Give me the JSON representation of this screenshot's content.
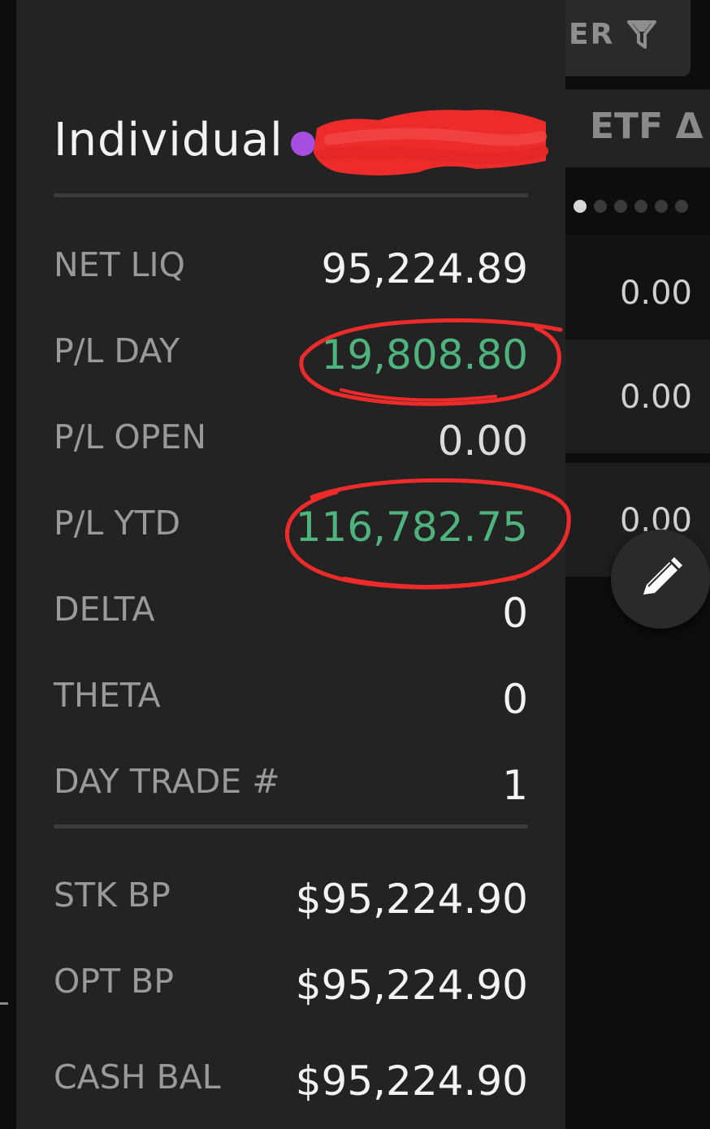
{
  "background": {
    "filter_label": "ER",
    "filter_icon": "filter-funnel-icon",
    "column_title": "ETF Δ",
    "page_dots": {
      "count": 6,
      "active_index": 0
    },
    "rows": [
      {
        "value": "0.00"
      },
      {
        "value": "0.00"
      },
      {
        "value": "0.00"
      }
    ],
    "fab_icon": "pencil-icon"
  },
  "drawer": {
    "account_name": "Individual",
    "account_dot_color": "#a64ee0",
    "stats": [
      {
        "label": "NET LIQ",
        "value": "95,224.89",
        "tone": "neutral"
      },
      {
        "label": "P/L DAY",
        "value": "19,808.80",
        "tone": "positive"
      },
      {
        "label": "P/L OPEN",
        "value": "0.00",
        "tone": "neutral"
      },
      {
        "label": "P/L YTD",
        "value": "116,782.75",
        "tone": "positive"
      },
      {
        "label": "DELTA",
        "value": "0",
        "tone": "neutral"
      },
      {
        "label": "THETA",
        "value": "0",
        "tone": "neutral"
      },
      {
        "label": "DAY TRADE #",
        "value": "1",
        "tone": "neutral"
      }
    ],
    "buying_power": [
      {
        "label": "STK BP",
        "value": "$95,224.90"
      },
      {
        "label": "OPT BP",
        "value": "$95,224.90"
      },
      {
        "label": "CASH BAL",
        "value": "$95,224.90"
      }
    ]
  },
  "colors": {
    "positive": "#4fb37e",
    "annotation_red": "#ee2b2b",
    "drawer_bg": "#232323"
  }
}
